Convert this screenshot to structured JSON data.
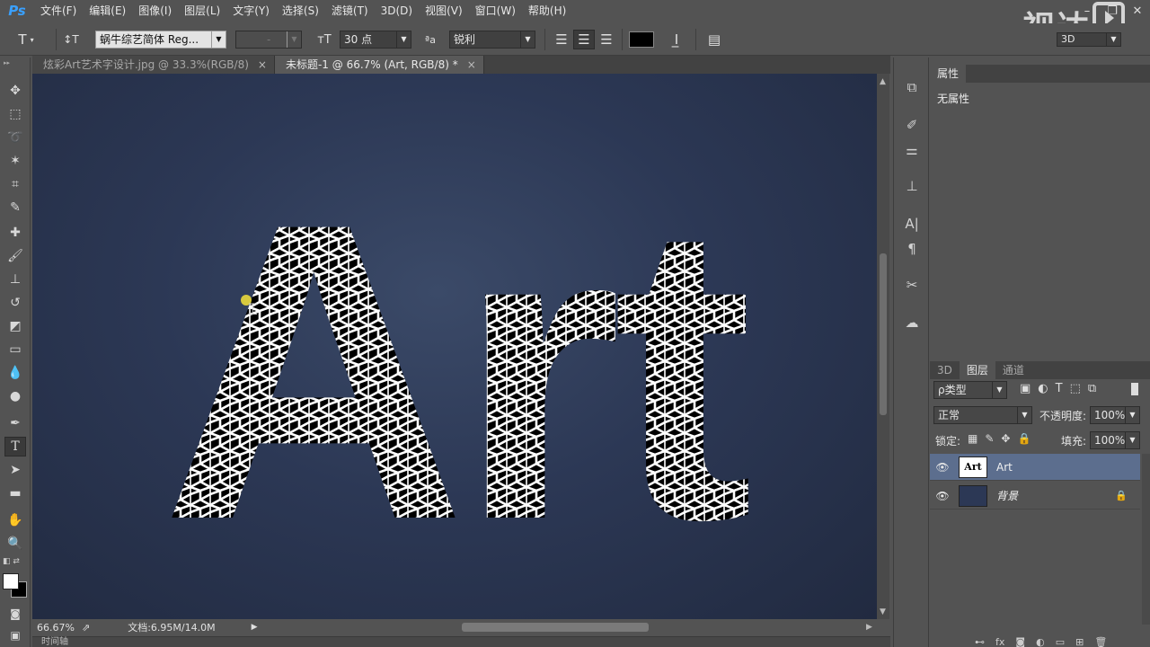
{
  "menubar": {
    "logo": "Ps",
    "items": [
      "文件(F)",
      "编辑(E)",
      "图像(I)",
      "图层(L)",
      "文字(Y)",
      "选择(S)",
      "滤镜(T)",
      "3D(D)",
      "视图(V)",
      "窗口(W)",
      "帮助(H)"
    ],
    "workspace": "3D"
  },
  "watermark": {
    "text": "视达"
  },
  "options": {
    "tool_glyph": "T",
    "orient_glyph": "↕T",
    "font_family": "蜗牛综艺简体 Reg...",
    "font_style": "-",
    "font_size_icon": "тT",
    "font_size": "30 点",
    "aa_icon": "ªa",
    "antialias": "锐利",
    "text_color": "#000000"
  },
  "tabs": [
    {
      "label": "炫彩Art艺术字设计.jpg @ 33.3%(RGB/8)",
      "close": "×"
    },
    {
      "label": "未标题-1 @ 66.7% (Art, RGB/8) *",
      "close": "×"
    }
  ],
  "canvas": {
    "text": "Art",
    "background": "#2c3855"
  },
  "status": {
    "zoom": "66.67%",
    "doc": "文档:6.95M/14.0M",
    "arrow": "▶"
  },
  "timeline": {
    "label": "时间轴"
  },
  "properties": {
    "tab": "属性",
    "content": "无属性"
  },
  "layers": {
    "tabs": [
      "3D",
      "图层",
      "通道"
    ],
    "filter": "ρ类型",
    "blend": "正常",
    "opacity_label": "不透明度:",
    "opacity": "100%",
    "lock_label": "锁定:",
    "fill_label": "填充:",
    "fill": "100%",
    "items": [
      {
        "name": "Art",
        "thumb": "Art",
        "selected": true
      },
      {
        "name": "背景",
        "thumb": "",
        "selected": false,
        "locked": true
      }
    ]
  },
  "colors": {
    "accent": "#3aa0ff",
    "selection": "#5c6e8e",
    "foreground": "#ffffff",
    "background": "#000000"
  }
}
